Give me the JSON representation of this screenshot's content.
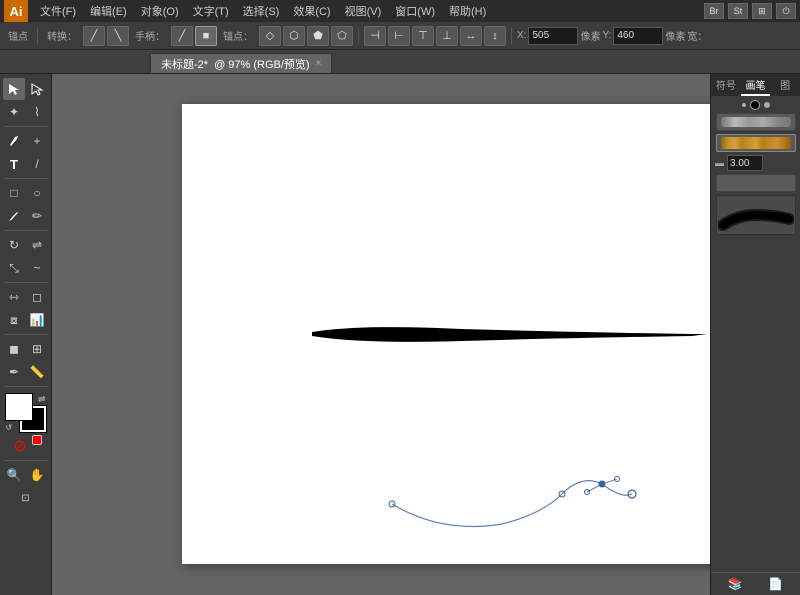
{
  "app": {
    "logo": "Ai",
    "logo_bg": "#cc6a00"
  },
  "menubar": {
    "items": [
      "文件(F)",
      "编辑(E)",
      "对象(O)",
      "文字(T)",
      "选择(S)",
      "效果(C)",
      "视图(V)",
      "窗口(W)",
      "帮助(H)"
    ]
  },
  "toolbar": {
    "label_anchor": "锚点",
    "label_convert": "转换：",
    "label_handle": "手柄：",
    "label_anchor2": "锚点：",
    "coord_x_label": "X:",
    "coord_x_value": "505",
    "coord_x_unit": "像素",
    "coord_y_label": "Y:",
    "coord_y_value": "460",
    "coord_y_unit": "像素",
    "width_label": "宽："
  },
  "tab": {
    "title": "未标题-2*",
    "mode": "@ 97% (RGB/预览)",
    "close": "×"
  },
  "right_panel": {
    "tabs": [
      "符号",
      "画笔",
      "图"
    ],
    "brush_size": "3.00",
    "bottom_icons": [
      "library-icon",
      "new-icon"
    ]
  },
  "canvas": {
    "bg_color": "#ffffff",
    "stroke_color": "#000000",
    "path_color": "#3a5fa0"
  }
}
